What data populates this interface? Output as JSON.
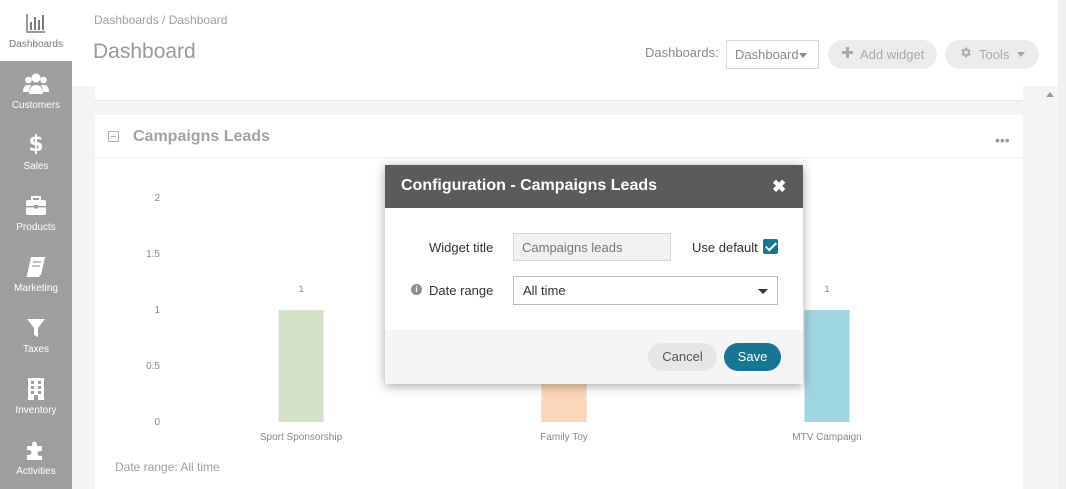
{
  "sidebar": {
    "items": [
      {
        "label": "Dashboards",
        "icon": "bar-chart-icon",
        "active": true
      },
      {
        "label": "Customers",
        "icon": "users-icon"
      },
      {
        "label": "Sales",
        "icon": "dollar-icon"
      },
      {
        "label": "Products",
        "icon": "briefcase-icon"
      },
      {
        "label": "Marketing",
        "icon": "book-icon"
      },
      {
        "label": "Taxes",
        "icon": "filter-icon"
      },
      {
        "label": "Inventory",
        "icon": "building-icon"
      },
      {
        "label": "Activities",
        "icon": "puzzle-icon"
      }
    ]
  },
  "header": {
    "breadcrumb": "Dashboards / Dashboard",
    "title": "Dashboard",
    "dashboards_label": "Dashboards:",
    "dashboard_select_value": "Dashboard",
    "add_widget_label": "Add widget",
    "tools_label": "Tools"
  },
  "panel": {
    "title": "Campaigns Leads",
    "date_range_note": "Date range: All time"
  },
  "chart_data": {
    "type": "bar",
    "categories": [
      "Sport Sponsorship",
      "Family Toy",
      "MTV Campaign"
    ],
    "values": [
      1,
      1,
      1
    ],
    "data_labels": [
      "1",
      "",
      "1"
    ],
    "colors": [
      "#d3e1c7",
      "#fcd6b6",
      "#9fd5e2"
    ],
    "yticks": [
      "0",
      "0.5",
      "1",
      "1.5",
      "2"
    ],
    "ylim": [
      0,
      2
    ],
    "grid": false
  },
  "modal": {
    "title": "Configuration - Campaigns Leads",
    "widget_title_label": "Widget title",
    "widget_title_placeholder": "Campaigns leads",
    "use_default_label": "Use default",
    "use_default_checked": true,
    "date_range_label": "Date range",
    "date_range_value": "All time",
    "cancel_label": "Cancel",
    "save_label": "Save"
  },
  "colors": {
    "accent": "#167698",
    "sidebar": "#9e9e9e",
    "modal_header": "#5b5b5b"
  }
}
